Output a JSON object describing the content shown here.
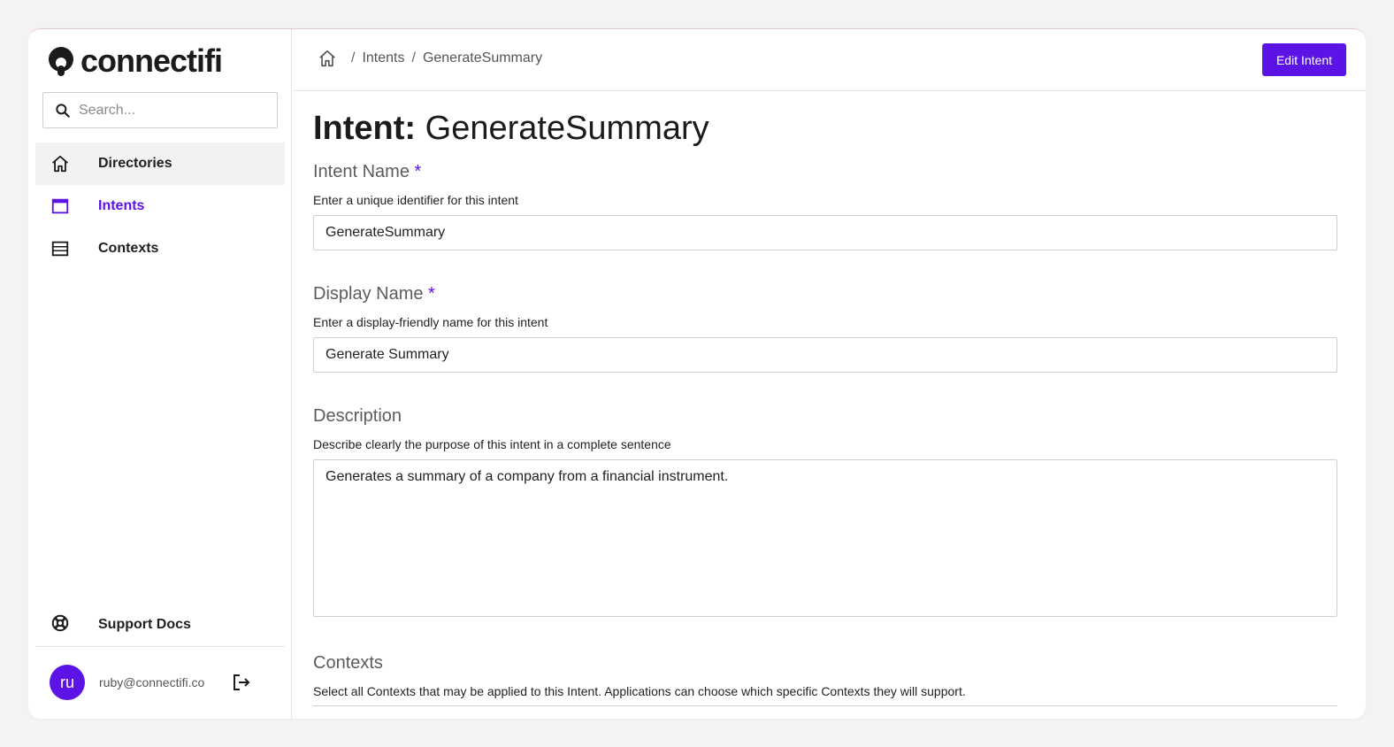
{
  "brand": {
    "name": "connectifi"
  },
  "search": {
    "placeholder": "Search..."
  },
  "sidebar": {
    "items": [
      {
        "label": "Directories",
        "icon": "home-icon"
      },
      {
        "label": "Intents",
        "icon": "window-icon"
      },
      {
        "label": "Contexts",
        "icon": "list-icon"
      }
    ],
    "support_label": "Support Docs",
    "user": {
      "initials": "ru",
      "email": "ruby@connectifi.co"
    }
  },
  "breadcrumb": {
    "items": [
      "Intents",
      "GenerateSummary"
    ]
  },
  "header": {
    "edit_label": "Edit Intent"
  },
  "page": {
    "title_prefix": "Intent:",
    "title_value": "GenerateSummary"
  },
  "form": {
    "intent_name": {
      "label": "Intent Name",
      "required": "*",
      "help": "Enter a unique identifier for this intent",
      "value": "GenerateSummary"
    },
    "display_name": {
      "label": "Display Name",
      "required": "*",
      "help": "Enter a display-friendly name for this intent",
      "value": "Generate Summary"
    },
    "description": {
      "label": "Description",
      "help": "Describe clearly the purpose of this intent in a complete sentence",
      "value": "Generates a summary of a company from a financial instrument."
    },
    "contexts": {
      "label": "Contexts",
      "help": "Select all Contexts that may be applied to this Intent. Applications can choose which specific Contexts they will support."
    }
  },
  "colors": {
    "accent": "#5b13e6",
    "background": "#f3f3f3"
  }
}
